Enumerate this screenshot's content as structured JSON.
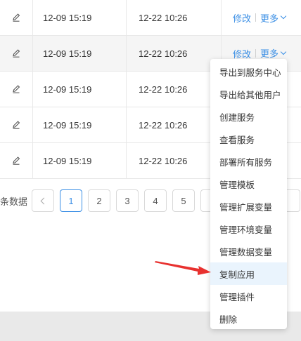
{
  "table": {
    "rows": [
      {
        "created": "12-09 15:19",
        "updated": "12-22 10:26",
        "edit_label": "修改",
        "more_label": "更多"
      },
      {
        "created": "12-09 15:19",
        "updated": "12-22 10:26",
        "edit_label": "修改",
        "more_label": "更多"
      },
      {
        "created": "12-09 15:19",
        "updated": "12-22 10:26"
      },
      {
        "created": "12-09 15:19",
        "updated": "12-22 10:26"
      },
      {
        "created": "12-09 15:19",
        "updated": "12-22 10:26"
      }
    ]
  },
  "pagination": {
    "label": "条数据",
    "pages": [
      "1",
      "2",
      "3",
      "4",
      "5"
    ],
    "current": "1"
  },
  "more_menu": {
    "items": [
      "导出到服务中心",
      "导出给其他用户",
      "创建服务",
      "查看服务",
      "部署所有服务",
      "管理模板",
      "管理扩展变量",
      "管理环境变量",
      "管理数据变量",
      "复制应用",
      "管理插件",
      "删除"
    ],
    "highlighted": "复制应用"
  },
  "colors": {
    "link": "#3b8fe5",
    "arrow": "#e8312f",
    "hover_bg": "#eaf4fd"
  },
  "icons": {
    "edit": "pencil-icon",
    "more": "chevron-down-icon",
    "prev": "chevron-left-icon",
    "next": "chevron-right-icon"
  }
}
